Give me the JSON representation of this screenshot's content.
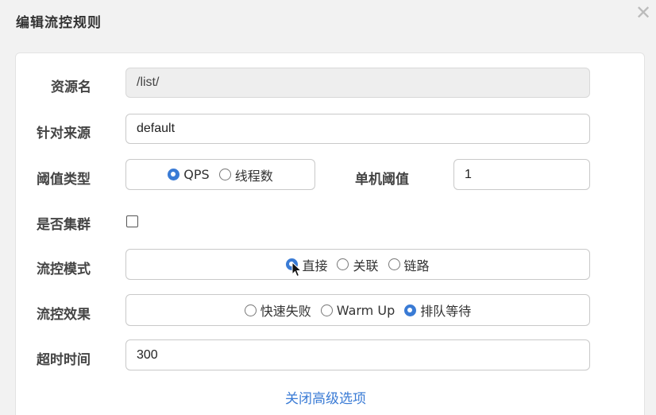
{
  "dialog": {
    "title": "编辑流控规则",
    "close_icon": "close-icon"
  },
  "form": {
    "resource": {
      "label": "资源名",
      "value": "/list/"
    },
    "limit_app": {
      "label": "针对来源",
      "value": "default"
    },
    "grade": {
      "label": "阈值类型",
      "options": [
        "QPS",
        "线程数"
      ],
      "selected": "QPS"
    },
    "count": {
      "label": "单机阈值",
      "value": "1"
    },
    "cluster": {
      "label": "是否集群",
      "checked": false
    },
    "strategy": {
      "label": "流控模式",
      "options": [
        "直接",
        "关联",
        "链路"
      ],
      "selected": "直接"
    },
    "control_behavior": {
      "label": "流控效果",
      "options": [
        "快速失败",
        "Warm Up",
        "排队等待"
      ],
      "selected": "排队等待"
    },
    "timeout": {
      "label": "超时时间",
      "value": "300"
    },
    "advanced_link": "关闭高级选项"
  },
  "colors": {
    "accent": "#3a7bd5",
    "border": "#c9c9c9",
    "disabled_bg": "#eeeeee"
  }
}
